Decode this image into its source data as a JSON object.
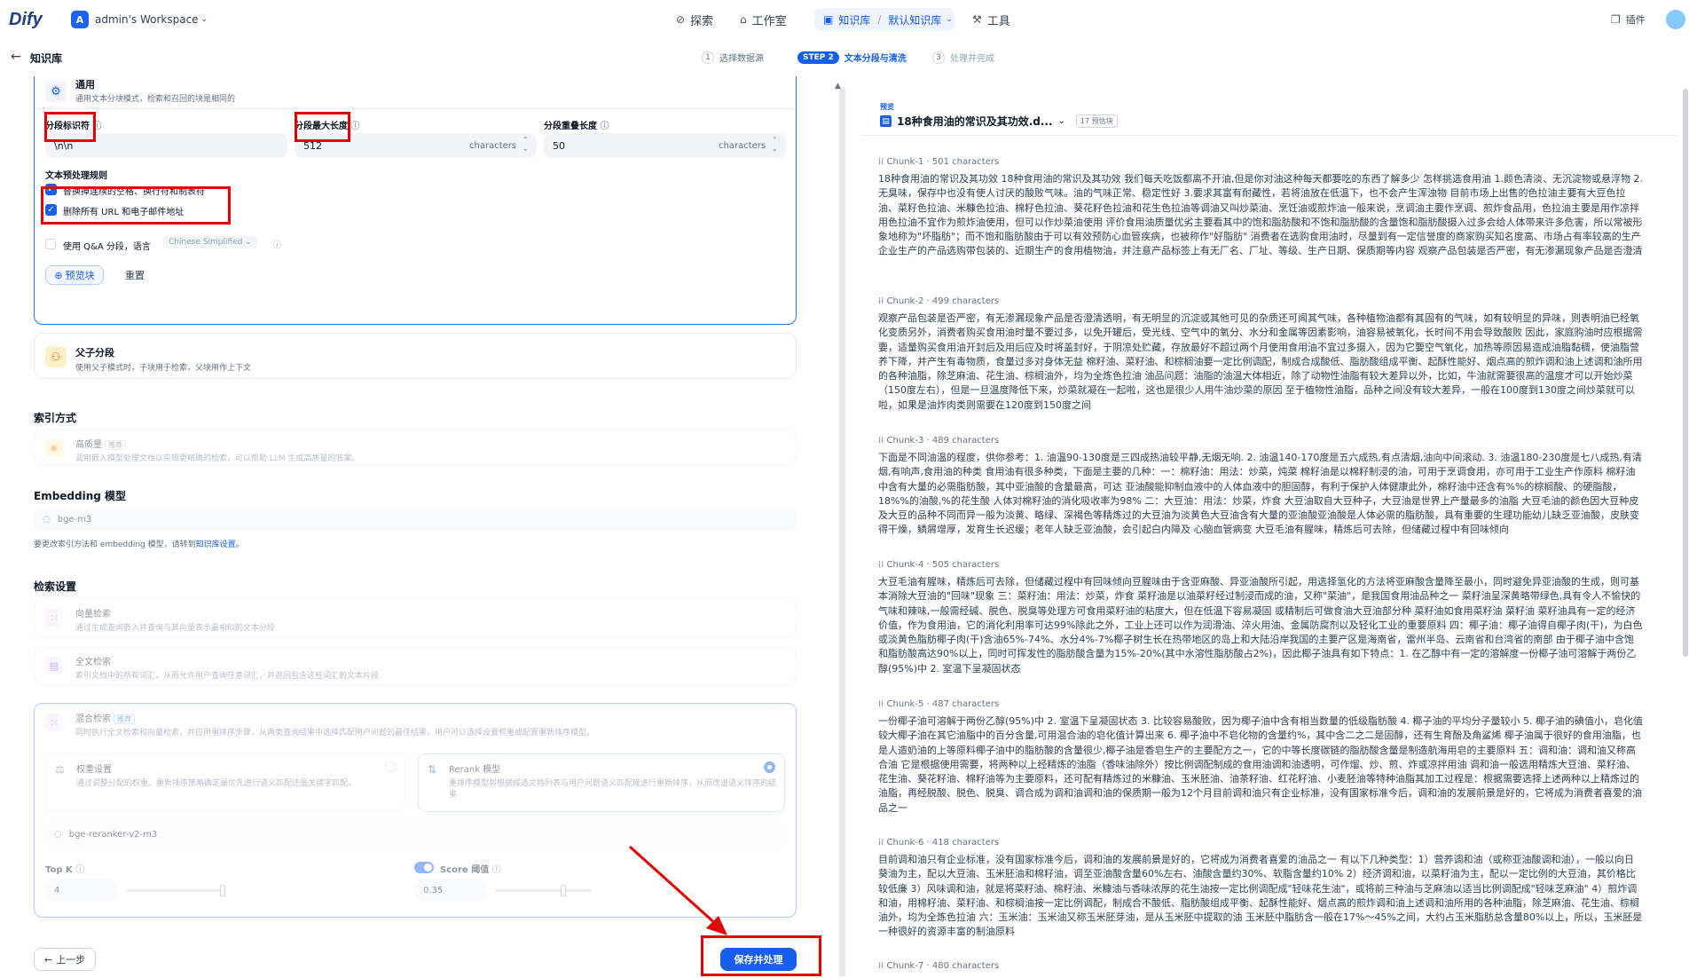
{
  "app": {
    "logo": "Dify",
    "workspace": "admin's Workspace",
    "workspace_initial": "A"
  },
  "nav": {
    "explore": "探索",
    "studio": "工作室",
    "knowledge": "知识库",
    "current_kb": "默认知识库",
    "tools": "工具",
    "plugins": "插件"
  },
  "breadcrumb": {
    "title": "知识库"
  },
  "steps": [
    {
      "num": "1",
      "label": "选择数据源"
    },
    {
      "num": "STEP 2",
      "label": "文本分段与清洗"
    },
    {
      "num": "3",
      "label": "处理并完成"
    }
  ],
  "general": {
    "title": "通用",
    "desc": "通用文本分块模式，检索和召回的块是相同的",
    "separator_label": "分段标识符",
    "separator_value": "\\n\\n",
    "max_len_label": "分段最大长度",
    "max_len_value": "512",
    "max_len_unit": "characters",
    "overlap_label": "分段重叠长度",
    "overlap_value": "50",
    "overlap_unit": "characters",
    "rules_title": "文本预处理规则",
    "rule1": "替换掉连续的空格、换行符和制表符",
    "rule2": "删除所有 URL 和电子邮件地址",
    "qa_label": "使用 Q&A 分段，语言",
    "qa_lang": "Chinese Simplified",
    "preview_btn": "预览块",
    "reset_btn": "重置"
  },
  "parent_child": {
    "title": "父子分段",
    "desc": "使用父子模式时，子块用于检索，父块用作上下文"
  },
  "index": {
    "section": "索引方式",
    "hq_title": "高质量",
    "hq_badge": "推荐",
    "hq_desc": "调用嵌入模型处理文档以实现更精确的检索，可以帮助 LLM 生成高质量的答案。"
  },
  "embedding": {
    "section": "Embedding 模型",
    "model": "bge-m3",
    "note": "要更改索引方法和 embedding 模型，请转到",
    "link": "知识库设置。"
  },
  "retrieval": {
    "section": "检索设置",
    "vector_title": "向量检索",
    "vector_desc": "通过生成查询嵌入并查询与其向量表示最相似的文本分段",
    "fulltext_title": "全文检索",
    "fulltext_desc": "索引文档中的所有词汇，从而允许用户查询任意词汇，并返回包含这些词汇的文本片段",
    "hybrid_title": "混合检索",
    "hybrid_badge": "推荐",
    "hybrid_desc": "同时执行全文检索和向量检索，并应用重排序步骤，从两类查询结果中选择匹配用户问题的最佳结果，用户可以选择设置权重或配置重新排序模型。",
    "weight_title": "权重设置",
    "weight_desc": "通过调整分配的权重，重新排序策略确定是优先进行语义匹配还是关键字匹配。",
    "rerank_title": "Rerank 模型",
    "rerank_desc": "重排序模型将根据候选文档列表与用户问题语义匹配度进行重新排序，从而改进语义排序的结果",
    "rerank_model": "bge-reranker-v2-m3",
    "topk_label": "Top K",
    "topk_value": "4",
    "score_label": "Score 阈值",
    "score_value": "0.35"
  },
  "footer": {
    "prev": "上一步",
    "save": "保存并处理"
  },
  "preview": {
    "label": "预览",
    "filename": "18种食用油的常识及其功效.d...",
    "chunk_count": "17 预估块",
    "chunks": [
      {
        "title": "Chunk-1 · 501 characters",
        "text": "18种食用油的常识及其功效 18种食用油的常识及其功效 我们每天吃饭都离不开油,但是你对油这种每天都要吃的东西了解多少 怎样挑选食用油 1.颜色清淡、无沉淀物或悬浮物 2.无臭味，保存中也没有使人讨厌的酸败气味。油的气味正常、稳定性好 3.要求其富有耐藏性，若将油放在低温下，也不会产生浑浊物 目前市场上出售的色拉油主要有大豆色拉油、菜籽色拉油、米糠色拉油、棉籽色拉油、葵花籽色拉油和花生色拉油等调油又叫炒菜油、烹饪油或煎炸油一般来说，烹调油主要作烹调、煎炸食品用，色拉油主要是用作凉拌用色拉油不宜作为煎炸油使用，但可以作炒菜油使用 评价食用油质量优劣主要看其中的饱和脂肪酸和不饱和脂肪酸的含量饱和脂肪酸摄入过多会给人体带来许多危害，所以常被形象地称为\"坏脂肪\"；而不饱和脂肪酸由于可以有效预防心血管疾病，也被称作\"好脂肪\" 消费者在选购食用油时，尽量到有一定信誉度的商家购买知名度高、市场占有率较高的生产企业生产的产品选购带包装的、近期生产的食用植物油，并注意产品标签上有无厂名、厂址、等级、生产日期、保质期等内容 观察产品包装是否严密，有无渗漏现象产品是否澄清透明，有无明显的沉淀或其他可见的杂质"
      },
      {
        "title": "Chunk-2 · 499 characters",
        "text": "观察产品包装是否严密，有无渗漏现象产品是否澄清透明，有无明显的沉淀或其他可见的杂质还可闻其气味，各种植物油都有其固有的气味，如有较明显的异味，则表明油已经氧化变质另外，消费者购买食用油时量不要过多，以免开罐后，受光线、空气中的氧分、水分和金属等因素影响，油容易被氧化，长时间不用会导致酸败 因此，家庭购油时应根据需要，适量购买食用油开封后及用后应及时将盖封好，于阴凉处贮藏，存放最好不超过两个月使用食用油不宜过多摄入，因为它要空气氧化，加热等原因易造成油脂黏稠，使油脂营养下降，并产生有毒物质，食量过多对身体无益 棉籽油、菜籽油、和棕榈油要一定比例调配，制成合成酸低、脂肪酸组成平衡、起酥性能好、烟点高的煎炸调和油上述调和油所用的各种油脂，除芝麻油、花生油、棕榈油外，均为全炼色拉油 油品问题：油脂的油温大体相近，除了动物性油脂有较大差异以外，比如，牛油就需要很高的温度才可以开始炒菜（150度左右），但是一旦温度降低下来，炒菜就凝在一起啦，这也是很少人用牛油炒菜的原因 至于植物性油脂，品种之间没有较大差异，一般在100度到130度之间炒菜就可以啦，如果是油炸肉类则需要在120度到150度之间"
      },
      {
        "title": "Chunk-3 · 489 characters",
        "text": "下面是不同油温的程度，供你参考：1. 油温90-130度是三四成热油较平静,无烟无响. 2. 油温140-170度是五六成热,有点清烟,油向中间滚动. 3. 油温180-230度是七八成热,有清烟,有响声,食用油的种类 食用油有很多种类，下面是主要的几种：一：棉籽油：用法：炒菜，炖菜 棉籽油是以棉籽制浸的油，可用于烹调食用，亦可用于工业生产作原料 棉籽油中含有大量的必需脂肪酸，其中亚油酸的含量最高，可达 亚油酸能抑制血液中的人体血液中的胆固醇，有利于保护人体健康此外，棉籽油中还含有%%的棕榈酸、的硬脂酸，18%%的油酸,%的花生酸 人体对棉籽油的消化吸收率为98% 二：大豆油：用法：炒菜，炸食 大豆油取自大豆种子，大豆油是世界上产量最多的油脂 大豆毛油的颜色因大豆种皮及大豆的品种不同而异一般为淡黄、略绿、深褐色等精炼过的大豆油为淡黄色大豆油含有大量的亚油酸亚油酸是人体必需的脂肪酸，具有重要的生理功能幼儿缺乏亚油酸，皮肤变得干燥，鳞屑增厚，发育生长迟缓；老年人缺乏亚油酸，会引起白内障及 心脑血管病变 大豆毛油有腥味，精炼后可去除，但储藏过程中有回味倾向"
      },
      {
        "title": "Chunk-4 · 505 characters",
        "text": "大豆毛油有腥味，精炼后可去除，但储藏过程中有回味倾向豆腥味由于含亚麻酸、异亚油酸所引起，用选择氢化的方法将亚麻酸含量降至最小，同时避免异亚油酸的生成，则可基本消除大豆油的\"回味\"现象 三：菜籽油：用法：炒菜，炸食 菜籽油是以油菜籽经过制浸而成的油，又称\"菜油\"，是我国食用油品种之一 菜籽油呈深黄略带绿色,具有令人不愉快的气味和辣味,一般需经碱、脱色、脱臭等处理方可食用菜籽油的粘度大，但在低温下容易凝固 或精制后可做食油大豆油部分种 菜籽油如食用菜籽油 菜籽油 菜籽油具有一定的经济价值，作为食用油，它的消化利用率可达99%除此之外，工业上还可以作为润滑油、淬火用油、金属防腐剂以及轻化工业的重要原料 四：椰子油：椰子油得自椰子肉(干)，为白色或淡黄色脂肪椰子肉(干)含油65%-74%、水分4%-7%椰子树生长在热带地区的岛上和大陆沿岸我国的主要产区是海南省，雷州半岛、云南省和台湾省的南部 由于椰子油中含饱和脂肪酸高达90%以上，同时可挥发性的脂肪酸含量为15%-20%(其中水溶性脂肪酸占2%)，因此椰子油具有如下特点：1. 在乙醇中有一定的溶解度一份椰子油可溶解于两份乙醇(95%)中 2. 室温下呈凝固状态"
      },
      {
        "title": "Chunk-5 · 487 characters",
        "text": "一份椰子油可溶解于两份乙醇(95%)中 2. 室温下呈凝固状态 3. 比较容易酸败，因为椰子油中含有相当数量的低级脂肪酸 4. 椰子油的平均分子量较小 5. 椰子油的碘值小，皂化值较大椰子油在其它油脂中的百分含量,可用混合油的皂化值计算出来 6. 椰子油中不皂化物的含量约%，其中含二之二是固醇，还有生育酚及角鲨烯 椰子油属于很好的食用油脂，也是人造奶油的上等原料椰子油中的脂肪酸的含量很少,椰子油是香皂生产的主要配方之一，它的中等长度碳链的脂肪酸含量是制造航海用皂的主要原料 五：调和油：调和油又称高合油 它是根据使用需要，将两种以上经精炼的油脂（香味油除外）按比例调配制成的食用油调和油透明，可作熘、炒、煎、炸或凉拌用油 调和油一般选用精炼大豆油、菜籽油、花生油、葵花籽油、棉籽油等为主要原料，还可配有精炼过的米糠油、玉米胚油、油茶籽油、红花籽油、小麦胚油等特种油脂其加工过程是：根据需要选择上述两种以上精炼过的油脂，再经脱酸、脱色、脱臭、调合成为调和油调和油的保质期一般为12个月目前调和油只有企业标准，没有国家标准今后，调和油的发展前景是好的，它将成为消费者喜爱的油品之一"
      },
      {
        "title": "Chunk-6 · 418 characters",
        "text": "目前调和油只有企业标准，没有国家标准今后，调和油的发展前景是好的，它将成为消费者喜爱的油品之一 有以下几种类型：1）营养调和油（或称亚油酸调和油），一般以向日葵油为主，配以大豆油、玉米胚油和棉籽油，调至亚油酸含量60%左右、油酸含量约30%、软脂含量约10% 2）经济调和油，以菜籽油为主，配以一定比例的大豆油，其价格比较低廉 3）风味调和油，就是将菜籽油、棉籽油、米糠油与香味浓厚的花生油按一定比例调配成\"轻味花生油\"，或将前三种油与芝麻油以适当比例调配成\"轻味芝麻油\" 4）煎炸调和油，用棉籽油、菜籽油、和棕榈油按一定比例调配，制成合不酸低、脂肪酸组成平衡、起酥性能好、烟点高的煎炸调和油上述调和油所用的各种油脂，除芝麻油、花生油、棕榈油外，均为全炼色拉油 六：玉米油：玉米油又称玉米胚芽油，是从玉米胚中提取的油 玉米胚中脂肪含一般在17%～45%之间，大约占玉米脂肪总含量80%以上，所以，玉米胚是一种很好的资源丰富的制油原料"
      },
      {
        "title": "Chunk-7 · 480 characters",
        "text": ""
      }
    ]
  }
}
